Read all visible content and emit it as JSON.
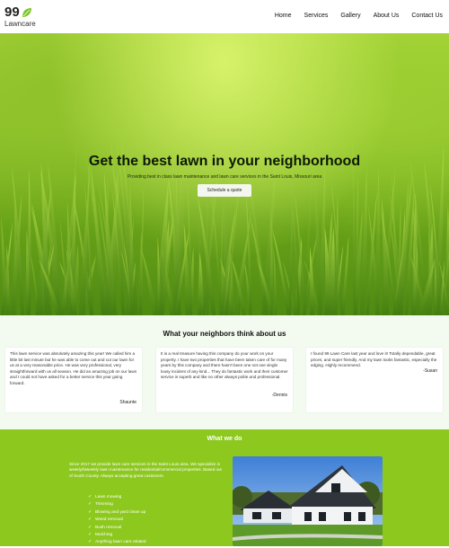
{
  "header": {
    "logo_number": "99",
    "logo_word": "Lawncare",
    "nav": [
      "Home",
      "Services",
      "Gallery",
      "About Us",
      "Contact Us"
    ]
  },
  "hero": {
    "title": "Get the best lawn in your neighborhood",
    "subtitle": "Providing best in class lawn maintenance and lawn care services in the Saint Louis, Missouri area",
    "cta": "Schedule a quote"
  },
  "testimonials": {
    "title": "What your neighbors think about us",
    "items": [
      {
        "text": "This lawn service was absolutely amazing this year! We called him a little bit last minute but he was able to come out and cut our lawn for us at a very reasonable price. He was very professional, very straightforward with us all season. He did an amazing job on our lawn and I could not have asked for a better service this year going forward.",
        "author": "Shaunte"
      },
      {
        "text": "It is a real treasure having this company do your work on your property. I have two properties that have been taken care of for many years by this company and there hasn't been one not one single lousy incident of any kind... They do fantastic work and their customer service is superb and like no other always polite and professional.",
        "author": "-Dennis"
      },
      {
        "text": "I found 99 Lawn Care last year and love it! Totally dependable, great prices, and super friendly. And my lawn looks fantastic, especially the edging. Highly recommend.",
        "author": "-Susan"
      }
    ]
  },
  "what_we_do": {
    "title": "What we do",
    "description": "Since 2017 we provide lawn care services in the Saint Louis area. We specialize in weekly/biweekly lawn maintenance for residential/commercial properties. Based out of South County. Always accepting great customers.",
    "services": [
      "Lawn mowing",
      "Trimming",
      "Blowing and yard clean up",
      "Weed removal",
      "Bush removal",
      "Mulching",
      "Anything lawn care related"
    ]
  },
  "colors": {
    "accent_green": "#8dc81e",
    "testimonial_bg": "#f3faf0",
    "logo_leaf": "#7cc52a"
  }
}
